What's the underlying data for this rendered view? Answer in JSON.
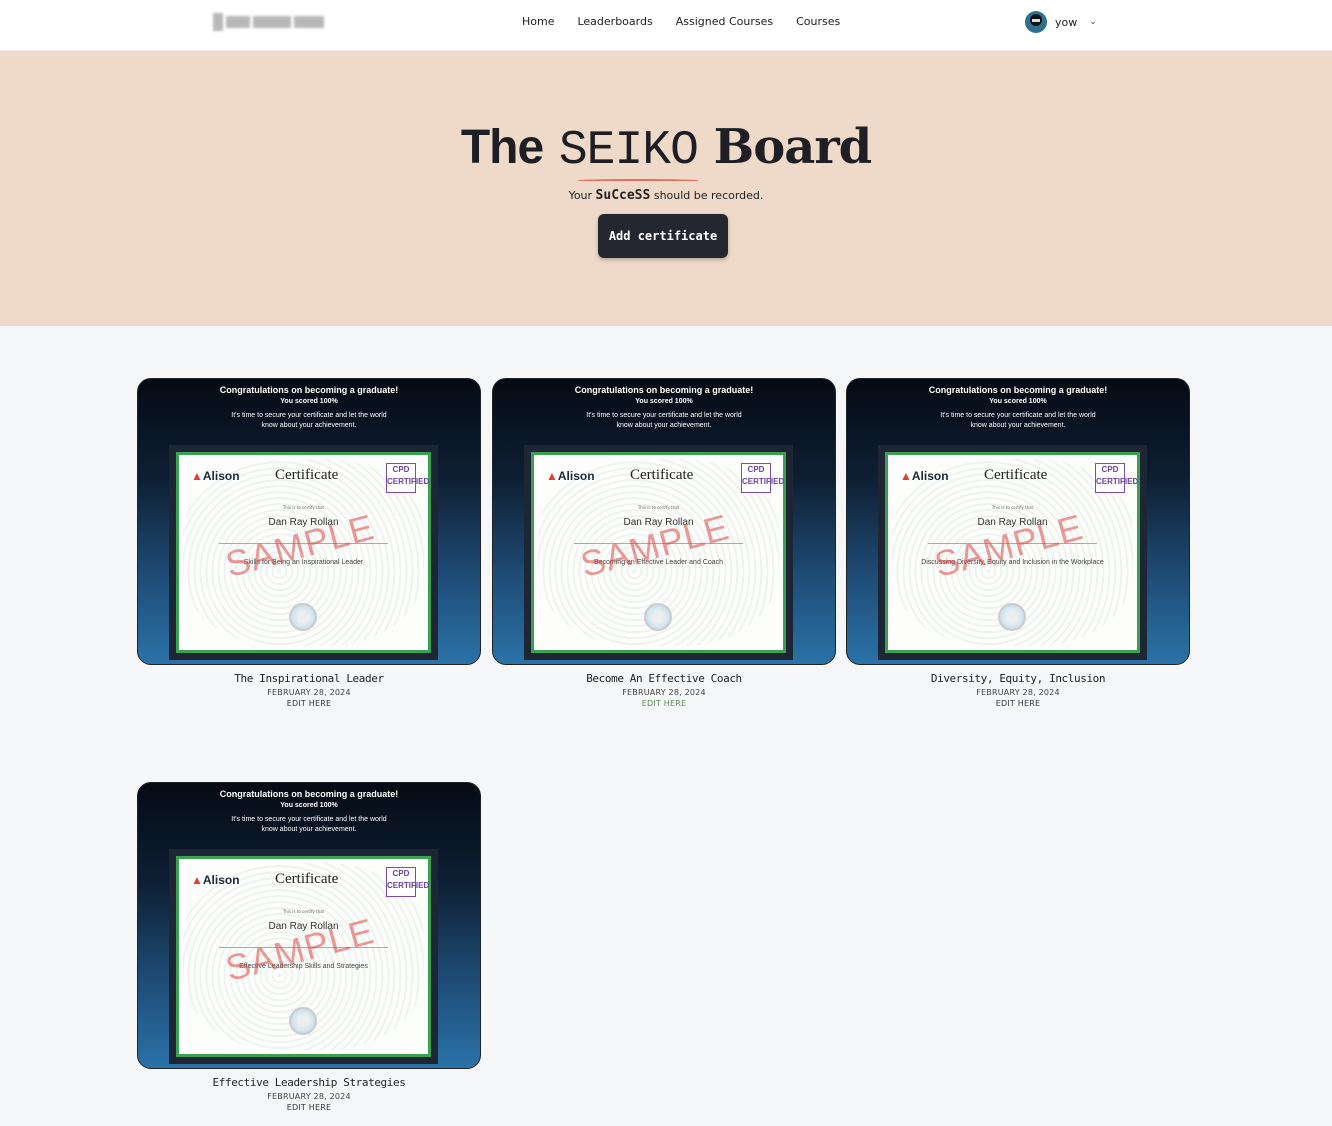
{
  "nav": {
    "links": [
      "Home",
      "Leaderboards",
      "Assigned Courses",
      "Courses"
    ],
    "username": "yow",
    "chevron_icon": "chevron-down-icon"
  },
  "hero": {
    "title_the": "The",
    "title_seiko": "SEIKO",
    "title_board": "Board",
    "tagline_pre": "Your",
    "tagline_em": "SuCceSS",
    "tagline_post": "should be recorded.",
    "add_button": "Add certificate"
  },
  "certificate_image": {
    "heading": "Congratulations on becoming a graduate!",
    "score": "You scored 100%",
    "subtext": "It's time to secure your certificate and let the world know about your achievement.",
    "brand": "Alison",
    "cert_word": "Certificate",
    "cpd_label": "CPD CERTIFIED",
    "certify_text": "This is to certify that",
    "recipient": "Dan Ray Rollan",
    "watermark": "SAMPLE"
  },
  "cards": [
    {
      "title": "The Inspirational Leader",
      "course": "Skills for Being an Inspirational Leader",
      "date": "FEBRUARY 28, 2024",
      "edit": "EDIT HERE",
      "edit_hover": false
    },
    {
      "title": "Become An Effective Coach",
      "course": "Becoming an Effective Leader and Coach",
      "date": "FEBRUARY 28, 2024",
      "edit": "EDIT HERE",
      "edit_hover": true
    },
    {
      "title": "Diversity, Equity, Inclusion",
      "course": "Discussing Diversity, Equity and Inclusion in the Workplace",
      "date": "FEBRUARY 28, 2024",
      "edit": "EDIT HERE",
      "edit_hover": false
    },
    {
      "title": "Effective Leadership Strategies",
      "course": "Effective Leadership Skills and Strategies",
      "date": "FEBRUARY 28, 2024",
      "edit": "EDIT HERE",
      "edit_hover": false
    }
  ],
  "colors": {
    "hero_bg": "#efdac9",
    "page_bg": "#f4f6f8",
    "button_bg": "#24272f",
    "cert_border": "#3aa152",
    "edit_hover": "#5a8f52"
  }
}
